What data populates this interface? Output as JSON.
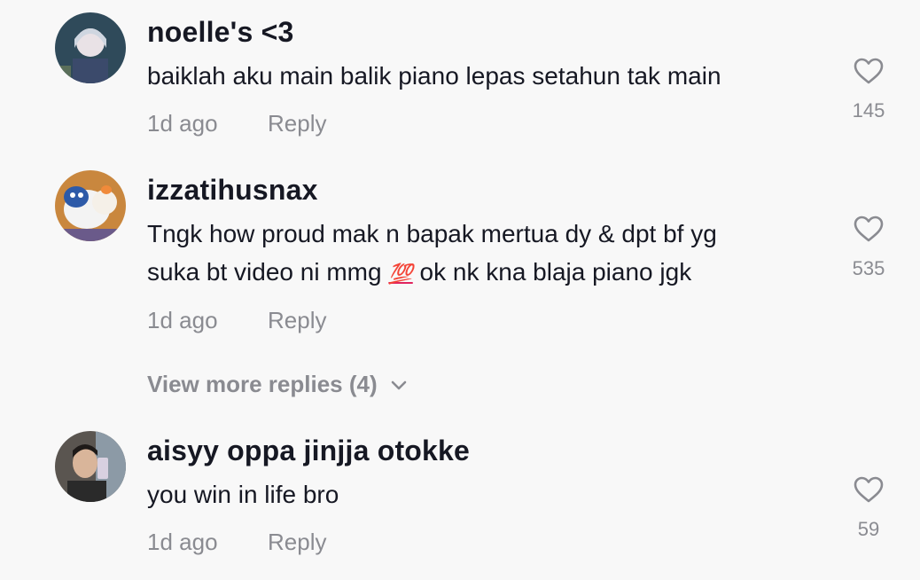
{
  "comments": [
    {
      "username": "noelle's <3",
      "lines": [
        "baiklah aku main balik piano lepas setahun tak main"
      ],
      "time": "1d ago",
      "reply": "Reply",
      "likes": "145"
    },
    {
      "username": "izzatihusnax",
      "lines": [
        "Tngk how proud mak n bapak mertua dy & dpt bf yg",
        "suka bt video ni mmg",
        "ok nk kna blaja piano jgk"
      ],
      "emoji": "💯",
      "time": "1d ago",
      "reply": "Reply",
      "likes": "535"
    },
    {
      "username": "aisyy oppa jinjja otokke",
      "lines": [
        "you win in life bro"
      ],
      "time": "1d ago",
      "reply": "Reply",
      "likes": "59"
    }
  ],
  "view_more_replies": "View more replies (4)",
  "icons": {
    "like": "heart-outline-icon",
    "expand": "chevron-down-icon"
  },
  "colors": {
    "background": "#f8f8f8",
    "text": "#161823",
    "muted": "#8a8b91"
  }
}
